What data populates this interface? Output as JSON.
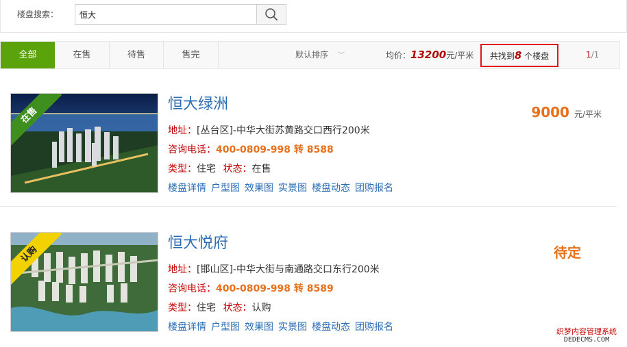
{
  "search": {
    "label": "楼盘搜索：",
    "value": "恒大"
  },
  "tabs": [
    {
      "label": "全部",
      "active": true
    },
    {
      "label": "在售",
      "active": false
    },
    {
      "label": "待售",
      "active": false
    },
    {
      "label": "售完",
      "active": false
    }
  ],
  "sort": {
    "label": "默认排序",
    "icon": "chevron-down-icon"
  },
  "avg_price": {
    "prefix": "均价：",
    "value": "13200",
    "unit": "元/平米"
  },
  "found": {
    "prefix": "共找到",
    "count": "8",
    "suffix": "个楼盘"
  },
  "pager": {
    "current": "1",
    "sep_total": "/1"
  },
  "listings": [
    {
      "badge": "在售",
      "badge_color": "#3f8f1f",
      "title": "恒大绿洲",
      "address_label": "地址：",
      "address": "[丛台区]-中华大街苏黄路交口西行200米",
      "phone_label": "咨询电话：",
      "phone": "400-0809-998 转 8588",
      "type_label": "类型：",
      "type": "住宅",
      "status_label": "状态：",
      "status": "在售",
      "price": "9000",
      "price_unit": "元/平米",
      "links": [
        "楼盘详情",
        "户型图",
        "效果图",
        "实景图",
        "楼盘动态",
        "团购报名"
      ]
    },
    {
      "badge": "认购",
      "badge_color": "#f2d200",
      "title": "恒大悦府",
      "address_label": "地址：",
      "address": "[邯山区]-中华大街与南通路交口东行200米",
      "phone_label": "咨询电话：",
      "phone": "400-0809-998 转 8589",
      "type_label": "类型：",
      "type": "住宅",
      "status_label": "状态：",
      "status": "认购",
      "price": "待定",
      "price_unit": "",
      "links": [
        "楼盘详情",
        "户型图",
        "效果图",
        "实景图",
        "楼盘动态",
        "团购报名"
      ]
    }
  ],
  "watermark": {
    "line1": "织梦内容管理系统",
    "line2": "DEDECMS.COM"
  }
}
